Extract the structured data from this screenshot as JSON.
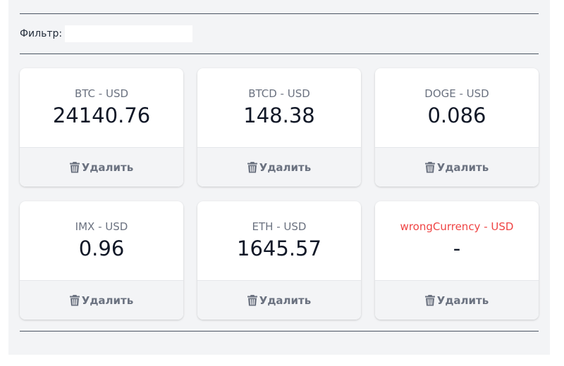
{
  "filter": {
    "label": "Фильтр:",
    "value": "",
    "placeholder": ""
  },
  "colors": {
    "background": "#f3f4f6",
    "card": "#ffffff",
    "error_text": "#ef4444",
    "muted_text": "#6b7280"
  },
  "tickers": [
    {
      "ticker": "BTC - USD",
      "price": "24140.76",
      "error": false,
      "delete_label": "Удалить",
      "icon": "trash-icon"
    },
    {
      "ticker": "BTCD - USD",
      "price": "148.38",
      "error": false,
      "delete_label": "Удалить",
      "icon": "trash-icon"
    },
    {
      "ticker": "DOGE - USD",
      "price": "0.086",
      "error": false,
      "delete_label": "Удалить",
      "icon": "trash-icon"
    },
    {
      "ticker": "IMX - USD",
      "price": "0.96",
      "error": false,
      "delete_label": "Удалить",
      "icon": "trash-icon"
    },
    {
      "ticker": "ETH - USD",
      "price": "1645.57",
      "error": false,
      "delete_label": "Удалить",
      "icon": "trash-icon"
    },
    {
      "ticker": "wrongCurrency - USD",
      "price": "-",
      "error": true,
      "delete_label": "Удалить",
      "icon": "trash-icon"
    }
  ]
}
